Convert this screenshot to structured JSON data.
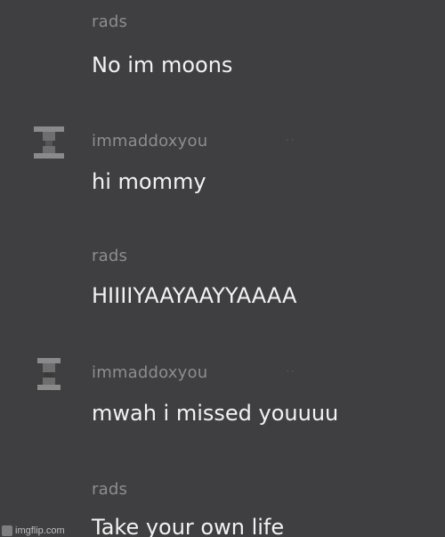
{
  "messages": [
    {
      "username": "rads",
      "text": "No im moons"
    },
    {
      "username": "immaddoxyou",
      "text": "hi mommy"
    },
    {
      "username": "rads",
      "text": "HIIIIYAAYAAYYAAAA"
    },
    {
      "username": "immaddoxyou",
      "text": "mwah i missed youuuu"
    },
    {
      "username": "rads",
      "text": "Take your own life"
    }
  ],
  "watermark": "imgflip.com",
  "colors": {
    "background": "#3f3f41",
    "username": "#8d8d90",
    "message_text": "#f2f2f2"
  }
}
